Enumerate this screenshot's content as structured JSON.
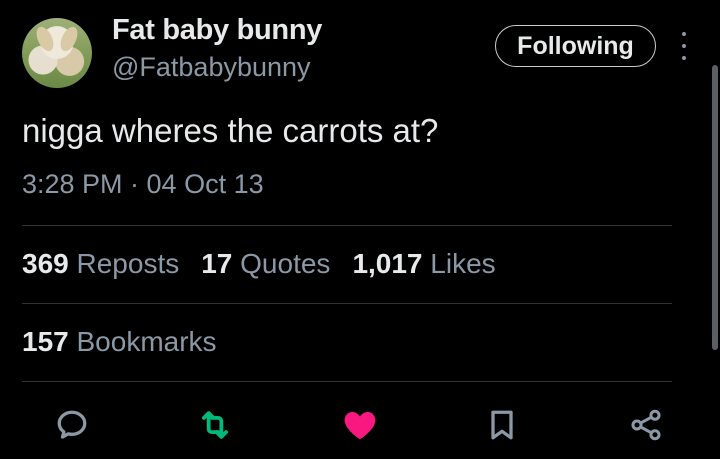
{
  "user": {
    "display_name": "Fat baby bunny",
    "handle": "@Fatbabybunny"
  },
  "follow_button": {
    "label": "Following"
  },
  "tweet": {
    "text": "nigga wheres the carrots at?",
    "timestamp": "3:28 PM · 04 Oct 13"
  },
  "stats": {
    "reposts": {
      "count": "369",
      "label": "Reposts"
    },
    "quotes": {
      "count": "17",
      "label": "Quotes"
    },
    "likes": {
      "count": "1,017",
      "label": "Likes"
    },
    "bookmarks": {
      "count": "157",
      "label": "Bookmarks"
    }
  },
  "actions": {
    "reply": {
      "icon": "reply-icon",
      "color": "#8b98a5"
    },
    "repost": {
      "icon": "repost-icon",
      "color": "#00ba7c"
    },
    "like": {
      "icon": "heart-icon",
      "color": "#f91880"
    },
    "bookmark": {
      "icon": "bookmark-icon",
      "color": "#8b98a5"
    },
    "share": {
      "icon": "share-icon",
      "color": "#8b98a5"
    }
  }
}
